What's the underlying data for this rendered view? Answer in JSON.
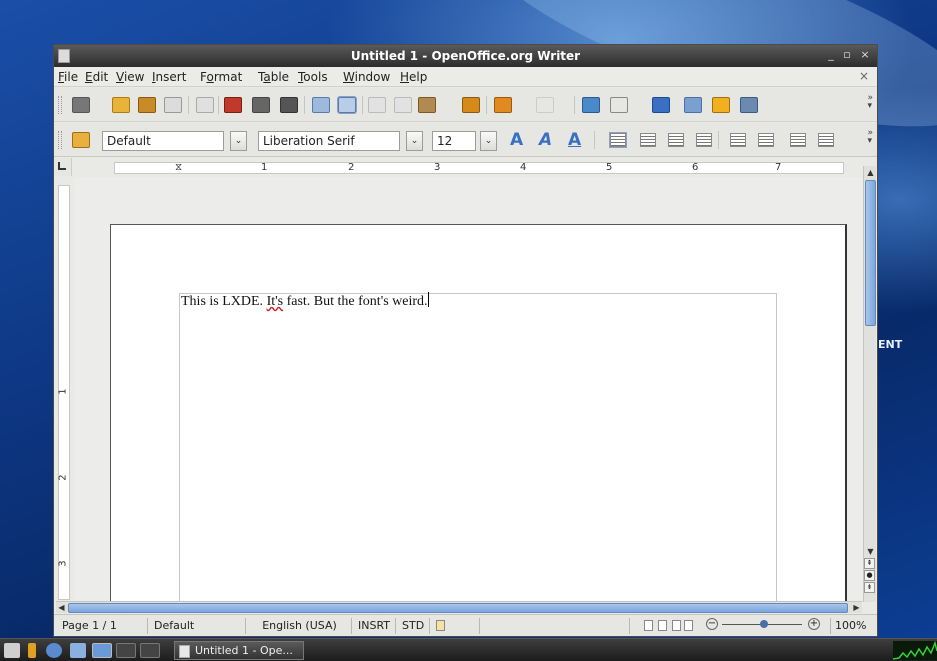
{
  "window": {
    "title": "Untitled 1 - OpenOffice.org Writer",
    "minimize": "_",
    "maximize": "▫",
    "close": "×"
  },
  "menubar": {
    "items": [
      {
        "u": "F",
        "rest": "ile"
      },
      {
        "u": "E",
        "rest": "dit"
      },
      {
        "u": "V",
        "rest": "iew"
      },
      {
        "u": "I",
        "rest": "nsert"
      },
      {
        "pre": "F",
        "u": "o",
        "rest": "rmat"
      },
      {
        "pre": "T",
        "u": "a",
        "rest": "ble"
      },
      {
        "u": "T",
        "rest": "ools"
      },
      {
        "u": "W",
        "rest": "indow"
      },
      {
        "u": "H",
        "rest": "elp"
      }
    ],
    "doc_close": "×"
  },
  "formatting": {
    "style": "Default",
    "font": "Liberation Serif",
    "size": "12",
    "dropdown_arrow": "⌄"
  },
  "ruler": {
    "h_numbers": [
      "1",
      "2",
      "3",
      "4",
      "5",
      "6",
      "7"
    ],
    "v_numbers": [
      "1",
      "2",
      "3"
    ]
  },
  "document": {
    "text_before": "This is LXDE. ",
    "misspelled": "It's",
    "text_after": " fast. But the font's weird."
  },
  "statusbar": {
    "page": "Page 1 / 1",
    "style": "Default",
    "language": "English (USA)",
    "insert_mode": "INSRT",
    "selection_mode": "STD",
    "zoom": "100%"
  },
  "taskbar": {
    "task_label": "Untitled 1 - Ope..."
  },
  "desktop": {
    "label": "ENT"
  },
  "colors": {
    "accent": "#3a6fc2",
    "titlebar": "#2c2c2c",
    "scroll_thumb": "#7aa6dc"
  }
}
